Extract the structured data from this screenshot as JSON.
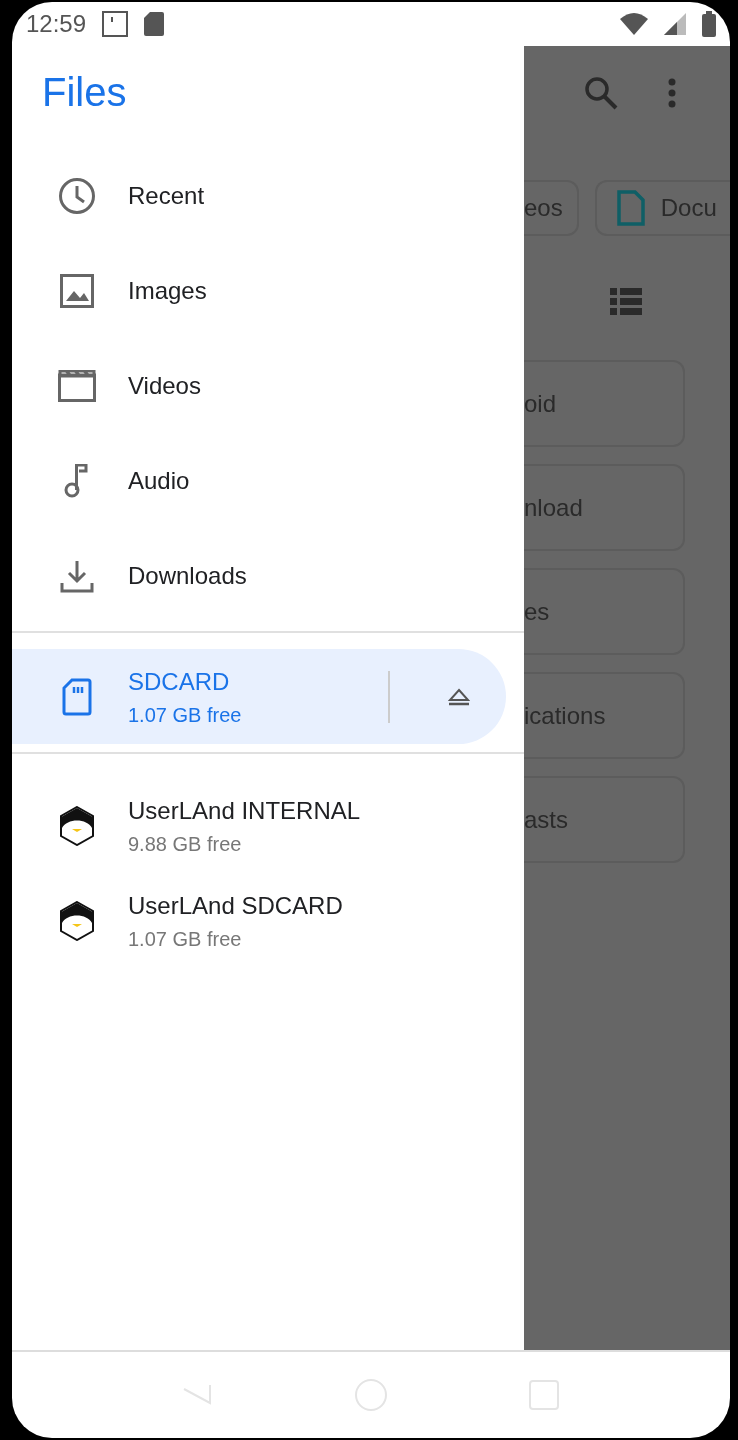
{
  "status_bar": {
    "time": "12:59"
  },
  "drawer": {
    "title": "Files",
    "items": [
      {
        "kind": "recent",
        "label": "Recent",
        "selected": false
      },
      {
        "kind": "images",
        "label": "Images",
        "selected": false
      },
      {
        "kind": "videos",
        "label": "Videos",
        "selected": false
      },
      {
        "kind": "audio",
        "label": "Audio",
        "selected": false
      },
      {
        "kind": "downloads",
        "label": "Downloads",
        "selected": false
      }
    ],
    "storage": [
      {
        "kind": "sdcard",
        "label": "SDCARD",
        "free": "1.07 GB free",
        "selected": true,
        "ejectable": true
      }
    ],
    "apps": [
      {
        "kind": "userland",
        "label": "UserLAnd INTERNAL",
        "free": "9.88 GB free",
        "selected": false
      },
      {
        "kind": "userland",
        "label": "UserLAnd SDCARD",
        "free": "1.07 GB free",
        "selected": false
      }
    ]
  },
  "background": {
    "chips": [
      {
        "label": "eos",
        "icon": false
      },
      {
        "label": "Docu",
        "icon": true
      }
    ],
    "folders": [
      "oid",
      "nload",
      "es",
      "ications",
      "asts"
    ]
  }
}
